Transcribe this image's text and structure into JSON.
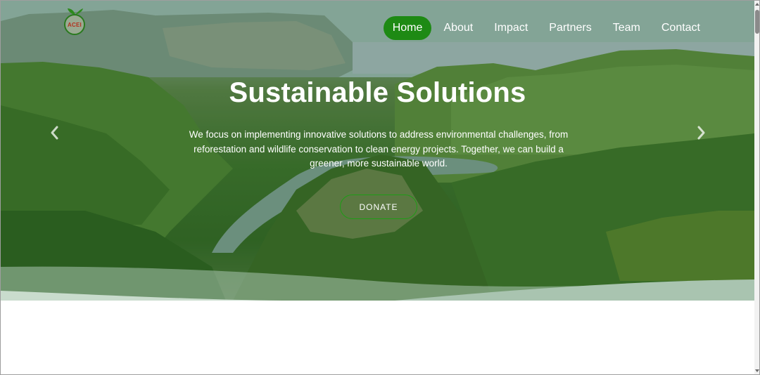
{
  "logo": {
    "text": "ACEI"
  },
  "nav": {
    "items": [
      {
        "label": "Home",
        "active": true
      },
      {
        "label": "About",
        "active": false
      },
      {
        "label": "Impact",
        "active": false
      },
      {
        "label": "Partners",
        "active": false
      },
      {
        "label": "Team",
        "active": false
      },
      {
        "label": "Contact",
        "active": false
      }
    ]
  },
  "hero": {
    "title": "Sustainable Solutions",
    "description": "We focus on implementing innovative solutions to address environmental challenges, from reforestation and wildlife conservation to clean energy projects. Together, we can build a greener, more sustainable world.",
    "cta_label": "DONATE",
    "prev_icon": "chevron-left-icon",
    "next_icon": "chevron-right-icon"
  },
  "colors": {
    "accent": "#1e8a14",
    "cta_border": "#1e9d16",
    "wave": "#a9c4b0",
    "text_on_hero": "#ffffff"
  }
}
